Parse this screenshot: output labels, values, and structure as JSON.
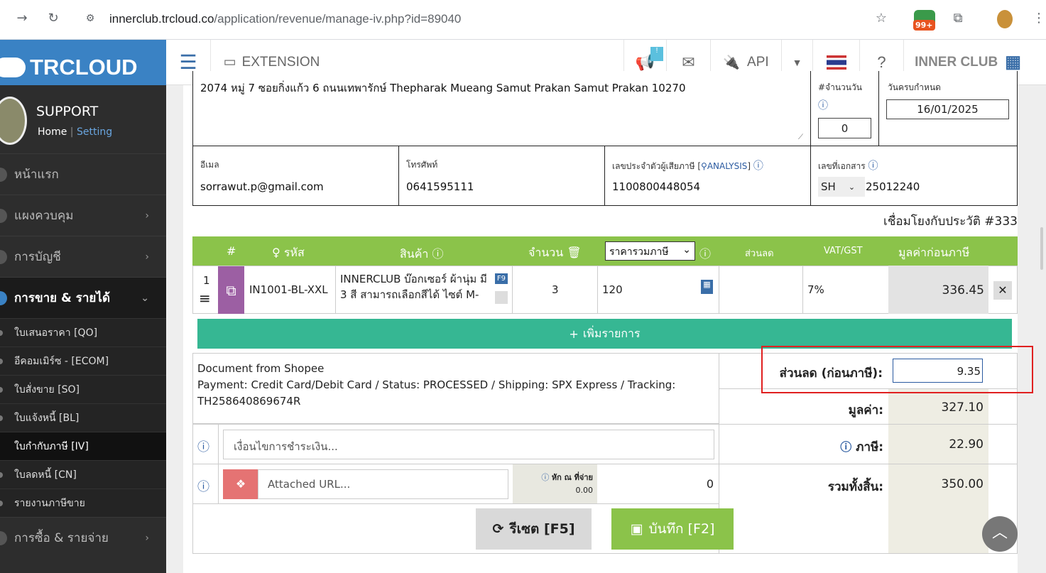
{
  "browser": {
    "url_host": "innerclub.trcloud.co",
    "url_path": "/application/revenue/manage-iv.php?id=89040",
    "ext_badge": "99+"
  },
  "header": {
    "logo": "TRCLOUD",
    "extension": "EXTENSION",
    "api": "API",
    "inner_club": "INNER CLUB",
    "notify_badge": "!"
  },
  "sidebar": {
    "user": "SUPPORT",
    "home": "Home",
    "sep": "|",
    "setting": "Setting",
    "items": [
      {
        "label": "หน้าแรก"
      },
      {
        "label": "แผงควบคุม"
      },
      {
        "label": "การบัญชี"
      },
      {
        "label": "การขาย & รายได้"
      }
    ],
    "subs": [
      {
        "label": "ใบเสนอราคา [QO]"
      },
      {
        "label": "อีคอมเมิร์ซ - [ECOM]"
      },
      {
        "label": "ใบสั่งขาย [SO]"
      },
      {
        "label": "ใบแจ้งหนี้ [BL]"
      },
      {
        "label": "ใบกำกับภาษี [IV]"
      },
      {
        "label": "ใบลดหนี้ [CN]"
      },
      {
        "label": "รายงานภาษีขาย"
      }
    ],
    "bottom": "การซื้อ & รายจ่าย"
  },
  "doc": {
    "address": "2074 หมู่ 7 ซอยกิ่งแก้ว 6 ถนนเทพารักษ์ Thepharak Mueang Samut Prakan Samut Prakan 10270",
    "credit_label": "#จำนวนวัน",
    "credit_days": "0",
    "due_label": "วันครบกำหนด",
    "due_date": "16/01/2025",
    "email_label": "อีเมล",
    "email": "sorrawut.p@gmail.com",
    "phone_label": "โทรศัพท์",
    "phone": "0641595111",
    "taxid_label": "เลขประจำตัวผู้เสียภาษี [",
    "analysis": "ANALYSIS",
    "taxid_close": "]",
    "taxid": "1100800448054",
    "docno_label": "เลขที่เอกสาร",
    "prefix": "SH",
    "docno": "25012240",
    "history": "เชื่อมโยงกับประวัติ #333"
  },
  "table": {
    "headers": {
      "no": "#",
      "code": "รหัส",
      "product": "สินค้า",
      "qty": "จำนวน",
      "price_mode": "ราคารวมภาษี",
      "discount": "ส่วนลด",
      "vat": "VAT/GST",
      "amount": "มูลค่าก่อนภาษี"
    },
    "rows": [
      {
        "no": "1",
        "code": "IN1001-BL-XXL",
        "product": "INNERCLUB บ๊อกเซอร์ ผ้านุ่ม มี 3 สี สามารถเลือกสีได้ ไซต์ M-",
        "f9": "F9",
        "qty": "3",
        "price": "120",
        "discount": "",
        "vat": "7%",
        "amount": "336.45"
      }
    ],
    "add": "เพิ่มรายการ"
  },
  "notes": {
    "line1": "Document from Shopee",
    "line2": "Payment: Credit Card/Debit Card / Status: PROCESSED / Shipping: SPX Express / Tracking: TH258640869674R"
  },
  "payment_placeholder": "เงื่อนไขการชำระเงิน...",
  "attach_placeholder": "Attached URL...",
  "wht_label": "หัก ณ ที่จ่าย",
  "wht_value": "0.00",
  "wht_amount": "0",
  "summary": {
    "discount_label": "ส่วนลด (ก่อนภาษี):",
    "discount": "9.35",
    "value_label": "มูลค่า:",
    "value": "327.10",
    "tax_label": "ภาษี:",
    "tax": "22.90",
    "total_label": "รวมทั้งสิ้น:",
    "total": "350.00"
  },
  "buttons": {
    "reset": "รีเซต [F5]",
    "save": "บันทึก [F2]"
  }
}
